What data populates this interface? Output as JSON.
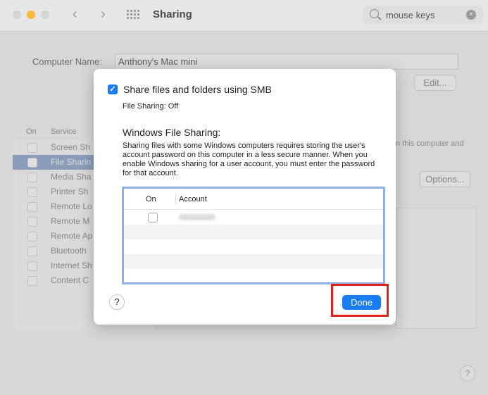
{
  "toolbar": {
    "back": "‹",
    "forward": "›",
    "title": "Sharing",
    "search_value": "mouse keys",
    "search_clear": "×"
  },
  "background": {
    "computer_name_label": "Computer Name:",
    "computer_name_value": "Anthony's Mac mini",
    "edit_button": "Edit...",
    "services_header_on": "On",
    "services_header_service": "Service",
    "services": [
      {
        "label": "Screen Sh",
        "selected": false
      },
      {
        "label": "File Sharin",
        "selected": true
      },
      {
        "label": "Media Sha",
        "selected": false
      },
      {
        "label": "Printer Sh",
        "selected": false
      },
      {
        "label": "Remote Lo",
        "selected": false
      },
      {
        "label": "Remote M",
        "selected": false
      },
      {
        "label": "Remote Ap",
        "selected": false
      },
      {
        "label": "Bluetooth",
        "selected": false
      },
      {
        "label": "Internet Sh",
        "selected": false
      },
      {
        "label": "Content C",
        "selected": false
      }
    ],
    "description_fragment": "n this computer and",
    "options_button": "Options...",
    "help_label": "?"
  },
  "sheet": {
    "smb_checkbox_checked": true,
    "smb_label": "Share files and folders using SMB",
    "file_sharing_status": "File Sharing: Off",
    "windows_title": "Windows File Sharing:",
    "windows_description": "Sharing files with some Windows computers requires storing the user's account password on this computer in a less secure manner. When you enable Windows sharing for a user account, you must enter the password for that account.",
    "table_header_on": "On",
    "table_header_account": "Account",
    "help_label": "?",
    "done_button": "Done"
  },
  "colors": {
    "accent": "#1a7cf0",
    "highlight": "#e0221b",
    "table_border": "#8fb1e6"
  }
}
